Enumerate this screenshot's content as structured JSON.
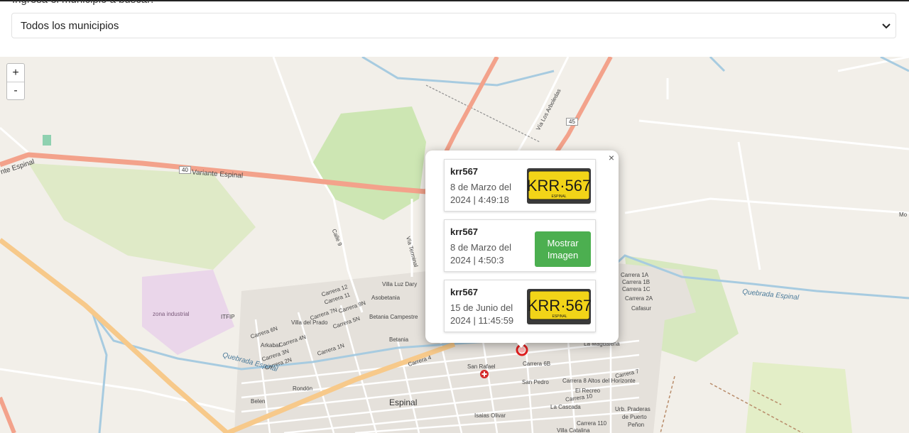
{
  "search": {
    "label": "Ingresa el municipio a buscar:",
    "selected": "Todos los municipios"
  },
  "map": {
    "zoom_in": "+",
    "zoom_out": "-",
    "labels": {
      "espinal": "Espinal",
      "variante": "Variante Espinal",
      "variante_left": "nte Espinal",
      "route40": "40",
      "route45": "45",
      "villa_arboledas": "Vía Los Arboledas",
      "calle9": "Calle 9",
      "via_terminal": "Vía Terminal",
      "villa_luz_dary": "Villa Luz Dary",
      "asobetania": "Asobetania",
      "betania_campestre": "Betania Campestre",
      "betania": "Betania",
      "villa_del_prado": "Villa del Prado",
      "zona_industrial": "zona industrial",
      "itfip": "ITFIP",
      "arkabal": "Arkabal",
      "rondon": "Rondón",
      "belen": "Belen",
      "san_rafael": "San Rafael",
      "san_pedro": "San Pedro",
      "el_recreo": "El Recreo",
      "la_cascada": "La Cascada",
      "la_magdalena": "La Magdalena",
      "cafasur": "Cafasur",
      "urb_praderas": "Urb. Praderas",
      "de_puerto": "de Puerto",
      "penon": "Peñon",
      "isaias_olivar": "Isaias Olivar",
      "altos_horizonte": "Carrera 8 Altos del Horizonte",
      "quebrada_espinal": "Quebrada Espinal",
      "quebrada_espinal_left": "Quebrada Espinal",
      "carrera4": "Carrera 4",
      "carrera12": "Carrera 12",
      "carrera11": "Carrera 11",
      "carrera9n": "Carrera 9N",
      "carrera7n": "Carrera 7N",
      "carrera6n": "Carrera 6N",
      "carrera5n": "Carrera 5N",
      "carrera4n": "Carrera 4N",
      "carrera3n": "Carrera 3N",
      "carrera2n": "Carrera 2N",
      "carrera1n": "Carrera 1N",
      "carrera6b": "Carrera 6B",
      "carrera7": "Carrera 7",
      "carrera10": "Carrera 10",
      "carrera1a": "Carrera 1A",
      "carrera1b": "Carrera 1B",
      "carrera1c": "Carrera 1C",
      "carrera2a": "Carrera 2A",
      "villa_catalina": "Villa Catalina",
      "carrera110": "Carrera 110",
      "mo": "Mo"
    }
  },
  "popup": {
    "close": "×",
    "cards": [
      {
        "title": "krr567",
        "date": "8 de Marzo del 2024 | 4:49:18",
        "plate": "KRR·567",
        "plate_city": "ESPINAL"
      },
      {
        "title": "krr567",
        "date": "8 de Marzo del 2024 | 4:50:3",
        "button": "Mostrar Imagen"
      },
      {
        "title": "krr567",
        "date": "15 de Junio del 2024 | 11:45:59",
        "plate": "KRR·567",
        "plate_city": "ESPINAL"
      }
    ]
  },
  "colors": {
    "highway": "#f3a28b",
    "primary_road": "#f7c98a",
    "water": "#a7cbe0",
    "green": "#cde6b3",
    "marker": "#e02020",
    "button": "#4caf50",
    "plate_yellow": "#f2d418"
  }
}
